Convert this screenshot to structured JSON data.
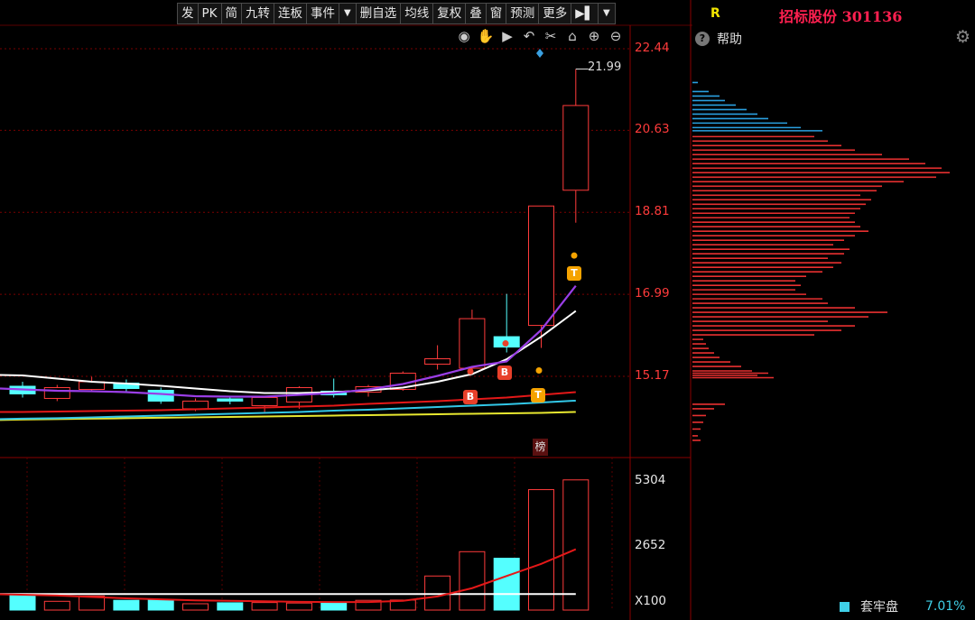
{
  "toolbar": {
    "items": [
      "发",
      "PK",
      "简",
      "九转",
      "连板",
      "事件",
      "▼",
      "删自选",
      "均线",
      "复权",
      "叠",
      "窗",
      "预测",
      "更多",
      "▶▌",
      "▼"
    ]
  },
  "header": {
    "r_label": "R",
    "stock_title": "招标股份 301136"
  },
  "help": {
    "label": "帮助"
  },
  "price_axis": {
    "labels": [
      "22.44",
      "20.63",
      "18.81",
      "16.99",
      "15.17"
    ]
  },
  "max_price_label": "21.99",
  "volume_axis": {
    "labels": [
      "5304",
      "2652",
      "X100"
    ]
  },
  "markers": {
    "b": "B",
    "t": "T",
    "bang": "榜"
  },
  "legend": {
    "name": "套牢盘",
    "percent": "7.01%"
  },
  "colors": {
    "up": "#ff3b3b",
    "down": "#54ffff",
    "ma_white": "#ffffff",
    "ma_purple": "#9a3ee6",
    "ma_red": "#e41818",
    "ma_cyan": "#32c8e8",
    "ma_yellow": "#e8e830",
    "chip_red": "#e83030",
    "chip_blue": "#2aa0e0"
  },
  "chart_data": {
    "type": "candlestick",
    "price_axis": {
      "ticks": [
        22.44,
        20.63,
        18.81,
        16.99,
        15.17
      ]
    },
    "candles": [
      {
        "open": 14.95,
        "close": 14.78,
        "high": 15.05,
        "low": 14.7
      },
      {
        "open": 14.68,
        "close": 14.92,
        "high": 14.98,
        "low": 14.62
      },
      {
        "open": 14.88,
        "close": 15.05,
        "high": 15.16,
        "low": 14.82
      },
      {
        "open": 15.02,
        "close": 14.9,
        "high": 15.1,
        "low": 14.84
      },
      {
        "open": 14.86,
        "close": 14.62,
        "high": 14.92,
        "low": 14.56
      },
      {
        "open": 14.45,
        "close": 14.62,
        "high": 14.68,
        "low": 14.4
      },
      {
        "open": 14.67,
        "close": 14.62,
        "high": 14.72,
        "low": 14.55
      },
      {
        "open": 14.52,
        "close": 14.7,
        "high": 14.74,
        "low": 14.38
      },
      {
        "open": 14.6,
        "close": 14.92,
        "high": 14.95,
        "low": 14.45
      },
      {
        "open": 14.84,
        "close": 14.76,
        "high": 15.12,
        "low": 14.7
      },
      {
        "open": 14.82,
        "close": 14.94,
        "high": 14.98,
        "low": 14.72
      },
      {
        "open": 14.88,
        "close": 15.24,
        "high": 15.28,
        "low": 14.85
      },
      {
        "open": 15.44,
        "close": 15.56,
        "high": 15.86,
        "low": 15.32
      },
      {
        "open": 15.35,
        "close": 16.45,
        "high": 16.65,
        "low": 15.3
      },
      {
        "open": 16.05,
        "close": 15.82,
        "high": 17.0,
        "low": 15.7
      },
      {
        "open": 16.3,
        "close": 18.95,
        "high": 18.95,
        "low": 15.8
      },
      {
        "open": 19.3,
        "close": 21.18,
        "high": 21.99,
        "low": 18.58
      }
    ],
    "ma_white": [
      15.2,
      15.19,
      15.12,
      15.05,
      15.01,
      14.96,
      14.9,
      14.84,
      14.8,
      14.8,
      14.82,
      14.86,
      14.92,
      15.05,
      15.22,
      15.55,
      16.05,
      16.62
    ],
    "ma_purple": [
      14.9,
      14.88,
      14.85,
      14.84,
      14.82,
      14.78,
      14.73,
      14.72,
      14.72,
      14.76,
      14.8,
      14.88,
      15.0,
      15.18,
      15.38,
      15.5,
      16.2,
      17.18
    ],
    "ma_red": [
      14.38,
      14.38,
      14.39,
      14.4,
      14.41,
      14.42,
      14.44,
      14.46,
      14.48,
      14.5,
      14.52,
      14.56,
      14.59,
      14.62,
      14.66,
      14.7,
      14.76,
      14.82
    ],
    "ma_cyan": [
      14.22,
      14.23,
      14.24,
      14.26,
      14.28,
      14.3,
      14.32,
      14.34,
      14.36,
      14.38,
      14.41,
      14.43,
      14.46,
      14.49,
      14.52,
      14.55,
      14.59,
      14.63
    ],
    "ma_yellow": [
      14.2,
      14.21,
      14.22,
      14.23,
      14.24,
      14.25,
      14.26,
      14.27,
      14.28,
      14.29,
      14.3,
      14.31,
      14.32,
      14.33,
      14.34,
      14.35,
      14.36,
      14.38
    ],
    "volume_axis": {
      "ticks": [
        5304,
        2652
      ]
    },
    "volumes": [
      650,
      360,
      580,
      400,
      420,
      260,
      300,
      310,
      290,
      320,
      400,
      410,
      1400,
      2400,
      2130,
      4950,
      5350
    ],
    "vol_ma_red": [
      650,
      600,
      540,
      480,
      440,
      400,
      380,
      360,
      340,
      330,
      330,
      380,
      560,
      900,
      1400,
      1900,
      2500
    ],
    "vol_ma_white": [
      660,
      660,
      660,
      660,
      660,
      660,
      660,
      660,
      660,
      660,
      660,
      660,
      660,
      660,
      660,
      660,
      660
    ],
    "chips": [
      [
        15.15,
        0.3
      ],
      [
        15.2,
        0.24
      ],
      [
        15.25,
        0.28
      ],
      [
        15.3,
        0.22
      ],
      [
        15.4,
        0.18
      ],
      [
        15.5,
        0.14
      ],
      [
        15.6,
        0.1
      ],
      [
        15.7,
        0.08
      ],
      [
        15.8,
        0.06
      ],
      [
        15.9,
        0.05
      ],
      [
        16.0,
        0.04
      ],
      [
        16.1,
        0.45
      ],
      [
        16.2,
        0.55
      ],
      [
        16.3,
        0.6
      ],
      [
        16.4,
        0.5
      ],
      [
        16.5,
        0.65
      ],
      [
        16.6,
        0.72
      ],
      [
        16.7,
        0.6
      ],
      [
        16.8,
        0.5
      ],
      [
        16.9,
        0.48
      ],
      [
        17.0,
        0.42
      ],
      [
        17.1,
        0.38
      ],
      [
        17.2,
        0.4
      ],
      [
        17.3,
        0.38
      ],
      [
        17.4,
        0.42
      ],
      [
        17.5,
        0.48
      ],
      [
        17.6,
        0.52
      ],
      [
        17.7,
        0.55
      ],
      [
        17.8,
        0.5
      ],
      [
        17.9,
        0.56
      ],
      [
        18.0,
        0.58
      ],
      [
        18.1,
        0.52
      ],
      [
        18.2,
        0.56
      ],
      [
        18.3,
        0.6
      ],
      [
        18.4,
        0.65
      ],
      [
        18.5,
        0.62
      ],
      [
        18.6,
        0.6
      ],
      [
        18.7,
        0.58
      ],
      [
        18.8,
        0.6
      ],
      [
        18.9,
        0.62
      ],
      [
        19.0,
        0.64
      ],
      [
        19.1,
        0.66
      ],
      [
        19.2,
        0.62
      ],
      [
        19.3,
        0.68
      ],
      [
        19.4,
        0.7
      ],
      [
        19.5,
        0.78
      ],
      [
        19.6,
        0.9
      ],
      [
        19.7,
        0.95
      ],
      [
        19.8,
        0.92
      ],
      [
        19.9,
        0.86
      ],
      [
        20.0,
        0.8
      ],
      [
        20.1,
        0.7
      ],
      [
        20.2,
        0.6
      ],
      [
        20.3,
        0.55
      ],
      [
        20.4,
        0.5
      ],
      [
        20.5,
        0.45
      ]
    ],
    "chips_blue": [
      [
        20.63,
        0.48
      ],
      [
        20.7,
        0.4
      ],
      [
        20.8,
        0.35
      ],
      [
        20.9,
        0.28
      ],
      [
        21.0,
        0.24
      ],
      [
        21.1,
        0.2
      ],
      [
        21.2,
        0.16
      ],
      [
        21.3,
        0.12
      ],
      [
        21.4,
        0.1
      ],
      [
        21.5,
        0.06
      ],
      [
        21.7,
        0.02
      ]
    ]
  }
}
